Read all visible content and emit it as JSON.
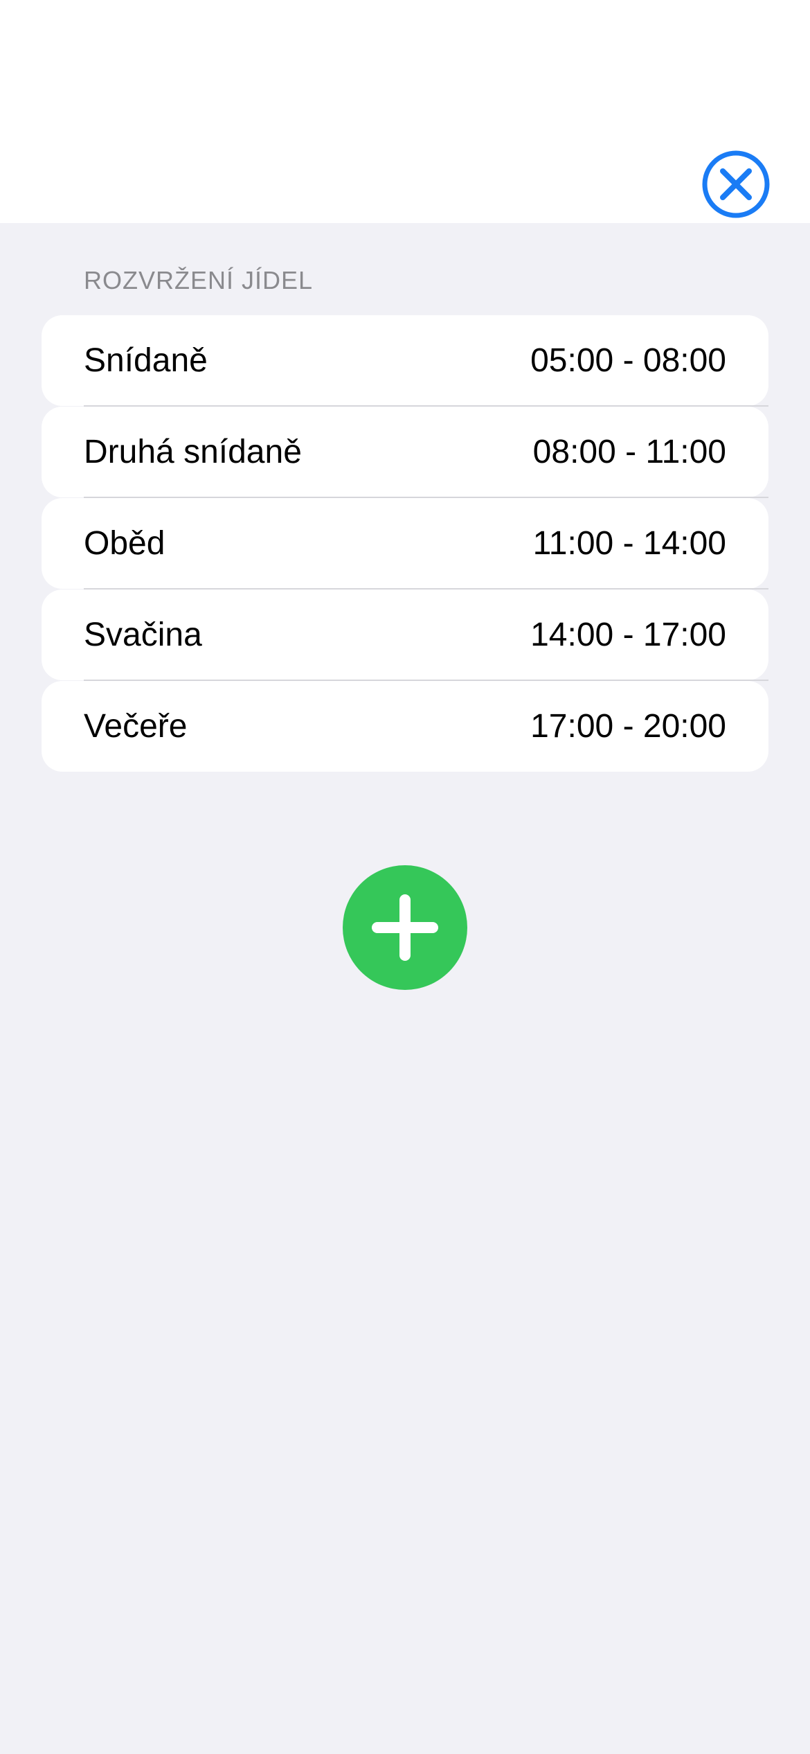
{
  "colors": {
    "background": "#f1f1f6",
    "card": "#ffffff",
    "accent_blue": "#1a7cf5",
    "add_green": "#35c759",
    "header_gray": "#8a8a8e"
  },
  "icons": {
    "close": "close-circle-icon",
    "add": "plus-icon"
  },
  "section": {
    "title": "ROZVRŽENÍ JÍDEL"
  },
  "meals": [
    {
      "name": "Snídaně",
      "time": "05:00 - 08:00"
    },
    {
      "name": "Druhá snídaně",
      "time": "08:00 - 11:00"
    },
    {
      "name": "Oběd",
      "time": "11:00 - 14:00"
    },
    {
      "name": "Svačina",
      "time": "14:00 - 17:00"
    },
    {
      "name": "Večeře",
      "time": "17:00 - 20:00"
    }
  ]
}
